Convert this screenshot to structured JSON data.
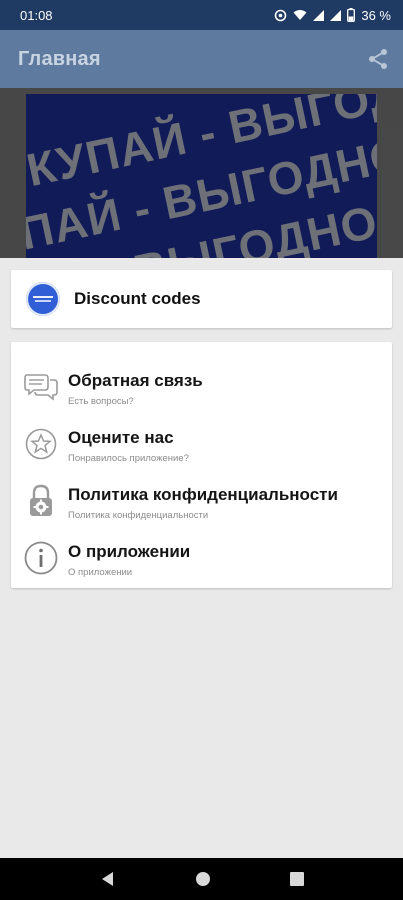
{
  "status_bar": {
    "time": "01:08",
    "battery": "36 %"
  },
  "app_bar": {
    "title": "Главная"
  },
  "banner": {
    "lines": [
      "ОКУПАЙ - ВЫГОДНО ПО",
      "УПАЙ - ВЫГОДНО ПОК",
      "ПАЙ - ВЫГОДНО ПОКУ"
    ]
  },
  "sheet": {
    "header_item": {
      "label": "Discount codes"
    },
    "items": [
      {
        "title": "Обратная связь",
        "subtitle": "Есть вопросы?",
        "icon": "chat-bubbles-icon"
      },
      {
        "title": "Оцените нас",
        "subtitle": "Понравилось приложение?",
        "icon": "star-icon"
      },
      {
        "title": "Политика конфиденциальности",
        "subtitle": "Политика конфиденциальности",
        "icon": "lock-gear-icon"
      },
      {
        "title": "О приложении",
        "subtitle": "О приложении",
        "icon": "info-icon"
      }
    ]
  },
  "colors": {
    "status_bar": "#1f3a63",
    "app_bar_dimmed": "#5f7a9f",
    "logo": "#2f5ed6",
    "banner": "#1b2a86"
  }
}
